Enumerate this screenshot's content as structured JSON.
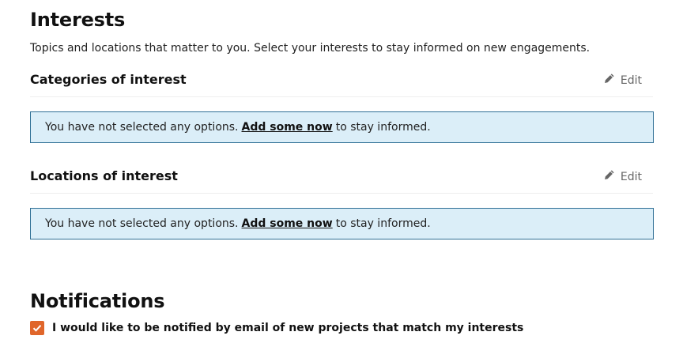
{
  "interests": {
    "title": "Interests",
    "intro": "Topics and locations that matter to you. Select your interests to stay informed on new engagements.",
    "categories": {
      "title": "Categories of interest",
      "edit_label": "Edit",
      "notice_prefix": "You have not selected any options.",
      "notice_link": "Add some now",
      "notice_suffix": "to stay informed."
    },
    "locations": {
      "title": "Locations of interest",
      "edit_label": "Edit",
      "notice_prefix": "You have not selected any options.",
      "notice_link": "Add some now",
      "notice_suffix": "to stay informed."
    }
  },
  "notifications": {
    "title": "Notifications",
    "checkbox_label": "I would like to be notified by email of new projects that match my interests",
    "checked": true
  },
  "colors": {
    "accent": "#e0662b",
    "notice_bg": "#dbeef8",
    "notice_border": "#2f6f95"
  }
}
